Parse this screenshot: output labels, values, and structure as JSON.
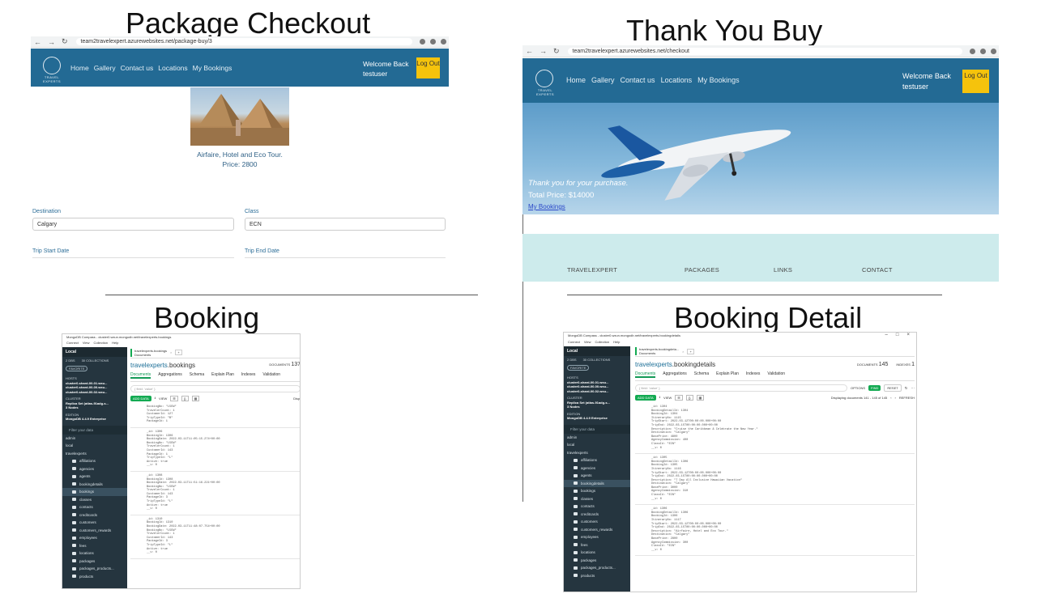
{
  "headings": {
    "checkout": "Package Checkout",
    "thankyou": "Thank You Buy",
    "booking": "Booking",
    "detail": "Booking Detail"
  },
  "site": {
    "logo_text": "TRAVEL EXPERTS",
    "nav": [
      "Home",
      "Gallery",
      "Contact us",
      "Locations",
      "My Bookings"
    ],
    "welcome_line1": "Welcome Back",
    "welcome_line2": "testuser",
    "logout": "Log Out"
  },
  "checkout": {
    "url": "team2travelexpert.azurewebsites.net/package-buy/3",
    "package_name": "Airfaire, Hotel and Eco Tour.",
    "price": "Price: 2800",
    "destination_label": "Destination",
    "destination_value": "Calgary",
    "class_label": "Class",
    "class_value": "ECN",
    "start_label": "Trip Start Date",
    "end_label": "Trip End Date"
  },
  "thankyou": {
    "url": "team2travelexpert.azurewebsites.net/checkout",
    "message": "Thank you for your purchase.",
    "total": "Total Price: $14000",
    "link": "My Bookings"
  },
  "footer": {
    "items": [
      "TRAVELEXPERT",
      "PACKAGES",
      "LINKS",
      "CONTACT"
    ]
  },
  "compass_booking": {
    "window_title": "MongoDB Compass - cluster0.wxun.mongodb.net/travelexperts.bookings",
    "menu": [
      "Connect",
      "View",
      "Collection",
      "Help"
    ],
    "local": "Local",
    "tab": "travelexperts.bookings",
    "tab_sub": "Documents",
    "db": "travelexperts",
    "collection": ".bookings",
    "documents_label": "DOCUMENTS",
    "documents_count": "137",
    "tabs": [
      "Documents",
      "Aggregations",
      "Schema",
      "Explain Plan",
      "Indexes",
      "Validation"
    ],
    "filter": "{ field: 'value' }",
    "add_data": "ADD DATA",
    "view": "VIEW",
    "display": "Displ",
    "dbs_label": "2 DBS",
    "colls_label": "30 COLLECTIONS",
    "favorite": "FAVORITE",
    "hosts_label": "HOSTS",
    "hosts": [
      "cluster0-shard-00-01.wxu...",
      "cluster0-shard-00-00.wxu...",
      "cluster0-shard-00-02.wxu..."
    ],
    "cluster_label": "CLUSTER",
    "cluster": "Replica Set (atlas-91adg-s...",
    "nodes": "3 Nodes",
    "edition_label": "EDITION",
    "edition": "MongoDB 4.4.9 Enterprise",
    "filter_data": "Filter your data",
    "tree": [
      "admin",
      "local",
      "travelexperts",
      "affiliations",
      "agencies",
      "agents",
      "bookingdetails",
      "bookings",
      "classes",
      "contacts",
      "creditcards",
      "customers",
      "customers_rewards",
      "employees",
      "fees",
      "locations",
      "packages",
      "packages_products...",
      "products"
    ],
    "docs": [
      "BookingNo: \"L5EW\"\nTravelerCount: 1\nCustomerId: 127\nTripTypeId: \"B\"\nPackageId: 1",
      "_id: 1306\nBookingId: 1306\nBookingDate: 2022-03-11T11:05:15.274+00:00\nBookingNo: \"L5EW\"\nTravelerCount: 1\nCustomerId: 143\nPackageId: 1\nTripTypeId: \"L\"\nActive: true\n__v: 0",
      "_id: 1308\nBookingId: 1308\nBookingDate: 2022-03-11T11:51:16.221+00:00\nBookingNo: \"L5EW\"\nTravelerCount: 1\nCustomerId: 143\nPackageId: 3\nTripTypeId: \"L\"\nActive: true\n__v: 0",
      "_id: 1310\nBookingId: 1310\nBookingDate: 2022-03-11T11:48:07.754+00:00\nBookingNo: \"L5EW\"\nTravelerCount: 1\nCustomerId: 143\nPackageId: 3\nTripTypeId: \"L\"\nActive: true\n__v: 0"
    ]
  },
  "compass_detail": {
    "window_title": "MongoDB Compass - cluster0.wxun.mongodb.net/travelexperts.bookingdetails",
    "menu": [
      "Connect",
      "View",
      "Collection",
      "Help"
    ],
    "local": "Local",
    "tab": "travelexperts.bookingdeta...",
    "tab_sub": "Documents",
    "db": "travelexperts",
    "collection": ".bookingdetails",
    "documents_label": "DOCUMENTS",
    "documents_count": "145",
    "indexes_label": "INDEXES",
    "indexes_count": "1",
    "tabs": [
      "Documents",
      "Aggregations",
      "Schema",
      "Explain Plan",
      "Indexes",
      "Validation"
    ],
    "filter": "{ field: 'value' }",
    "options": "OPTIONS",
    "find": "FIND",
    "reset": "RESET",
    "add_data": "ADD DATA",
    "view": "VIEW",
    "displaying": "Displaying documents 141 - 145 of 145",
    "refresh": "REFRESH",
    "dbs_label": "2 DBS",
    "colls_label": "30 COLLECTIONS",
    "favorite": "FAVORITE",
    "hosts_label": "HOSTS",
    "hosts": [
      "cluster0-shard-00-01.wxu...",
      "cluster0-shard-00-00.wxu...",
      "cluster0-shard-00-02.wxu..."
    ],
    "cluster_label": "CLUSTER",
    "cluster": "Replica Set (atlas-91adg-s...",
    "nodes": "3 Nodes",
    "edition_label": "EDITION",
    "edition": "MongoDB 4.4.9 Enterprise",
    "filter_data": "Filter your data",
    "tree": [
      "admin",
      "local",
      "travelexperts",
      "affiliations",
      "agencies",
      "agents",
      "bookingdetails",
      "bookings",
      "classes",
      "contacts",
      "creditcards",
      "customers",
      "customers_rewards",
      "employees",
      "fees",
      "locations",
      "packages",
      "packages_products...",
      "products"
    ],
    "docs": [
      "_id: 1304\nBookingDetailId: 1304\nBookingId: 1304\nItineraryNo: 1115\nTripStart: 2022-03-12T00:00:00.000+00:00\nTripEnd: 2022-03-15T00:00:00.000+00:00\nDescription: \"Cruise the Caribbean & Celebrate the New Year.\"\nDestination: \"Calgary\"\nBasePrice: 4800\nAgencyCommission: 400\nClassId: \"ECN\"\n__v: 0",
      "_id: 1305\nBookingDetailId: 1306\nBookingId: 1305\nItineraryNo: 1116\nTripStart: 2022-03-12T00:00:00.000+00:00\nTripEnd: 2022-03-15T00:00:00.000+00:00\nDescription: \"7 Day All Inclusive Hawaiian Vacation\"\nDestination: \"Calgary\"\nBasePrice: 3000\nAgencyCommission: 310\nClassId: \"ECN\"\n__v: 0",
      "_id: 1306\nBookingDetailId: 1306\nBookingId: 1306\nItineraryNo: 1117\nTripStart: 2022-03-12T00:00:00.000+00:00\nTripEnd: 2022-03-15T00:00:00.000+00:00\nDescription: \"Airfaire, Hotel and Eco Tour.\"\nDestination: \"Calgary\"\nBasePrice: 2800\nAgencyCommission: 300\nClassId: \"ECN\"\n__v: 0"
    ]
  }
}
